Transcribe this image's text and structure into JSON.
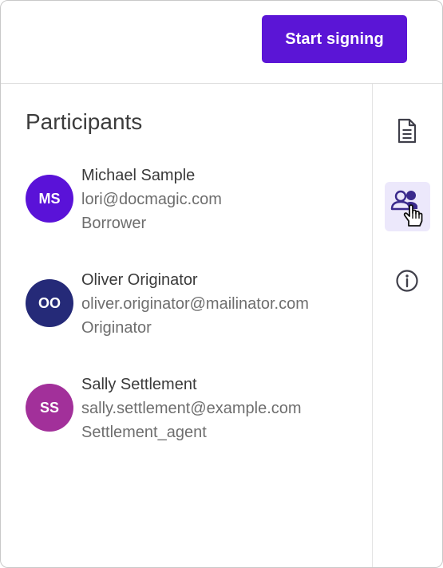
{
  "header": {
    "start_signing_label": "Start signing"
  },
  "participants_panel": {
    "title": "Participants",
    "participants": [
      {
        "initials": "MS",
        "name": "Michael Sample",
        "email": "lori@docmagic.com",
        "role": "Borrower",
        "avatar_color": "#5a12d8"
      },
      {
        "initials": "OO",
        "name": "Oliver Originator",
        "email": "oliver.originator@mailinator.com",
        "role": "Originator",
        "avatar_color": "#252a78"
      },
      {
        "initials": "SS",
        "name": "Sally Settlement",
        "email": "sally.settlement@example.com",
        "role": "Settlement_agent",
        "avatar_color": "#a2309a"
      }
    ]
  },
  "sidebar": {
    "icons": [
      {
        "name": "document-icon",
        "active": false
      },
      {
        "name": "participants-icon",
        "active": true
      },
      {
        "name": "info-icon",
        "active": false
      }
    ],
    "accent_color": "#5b15d6"
  }
}
